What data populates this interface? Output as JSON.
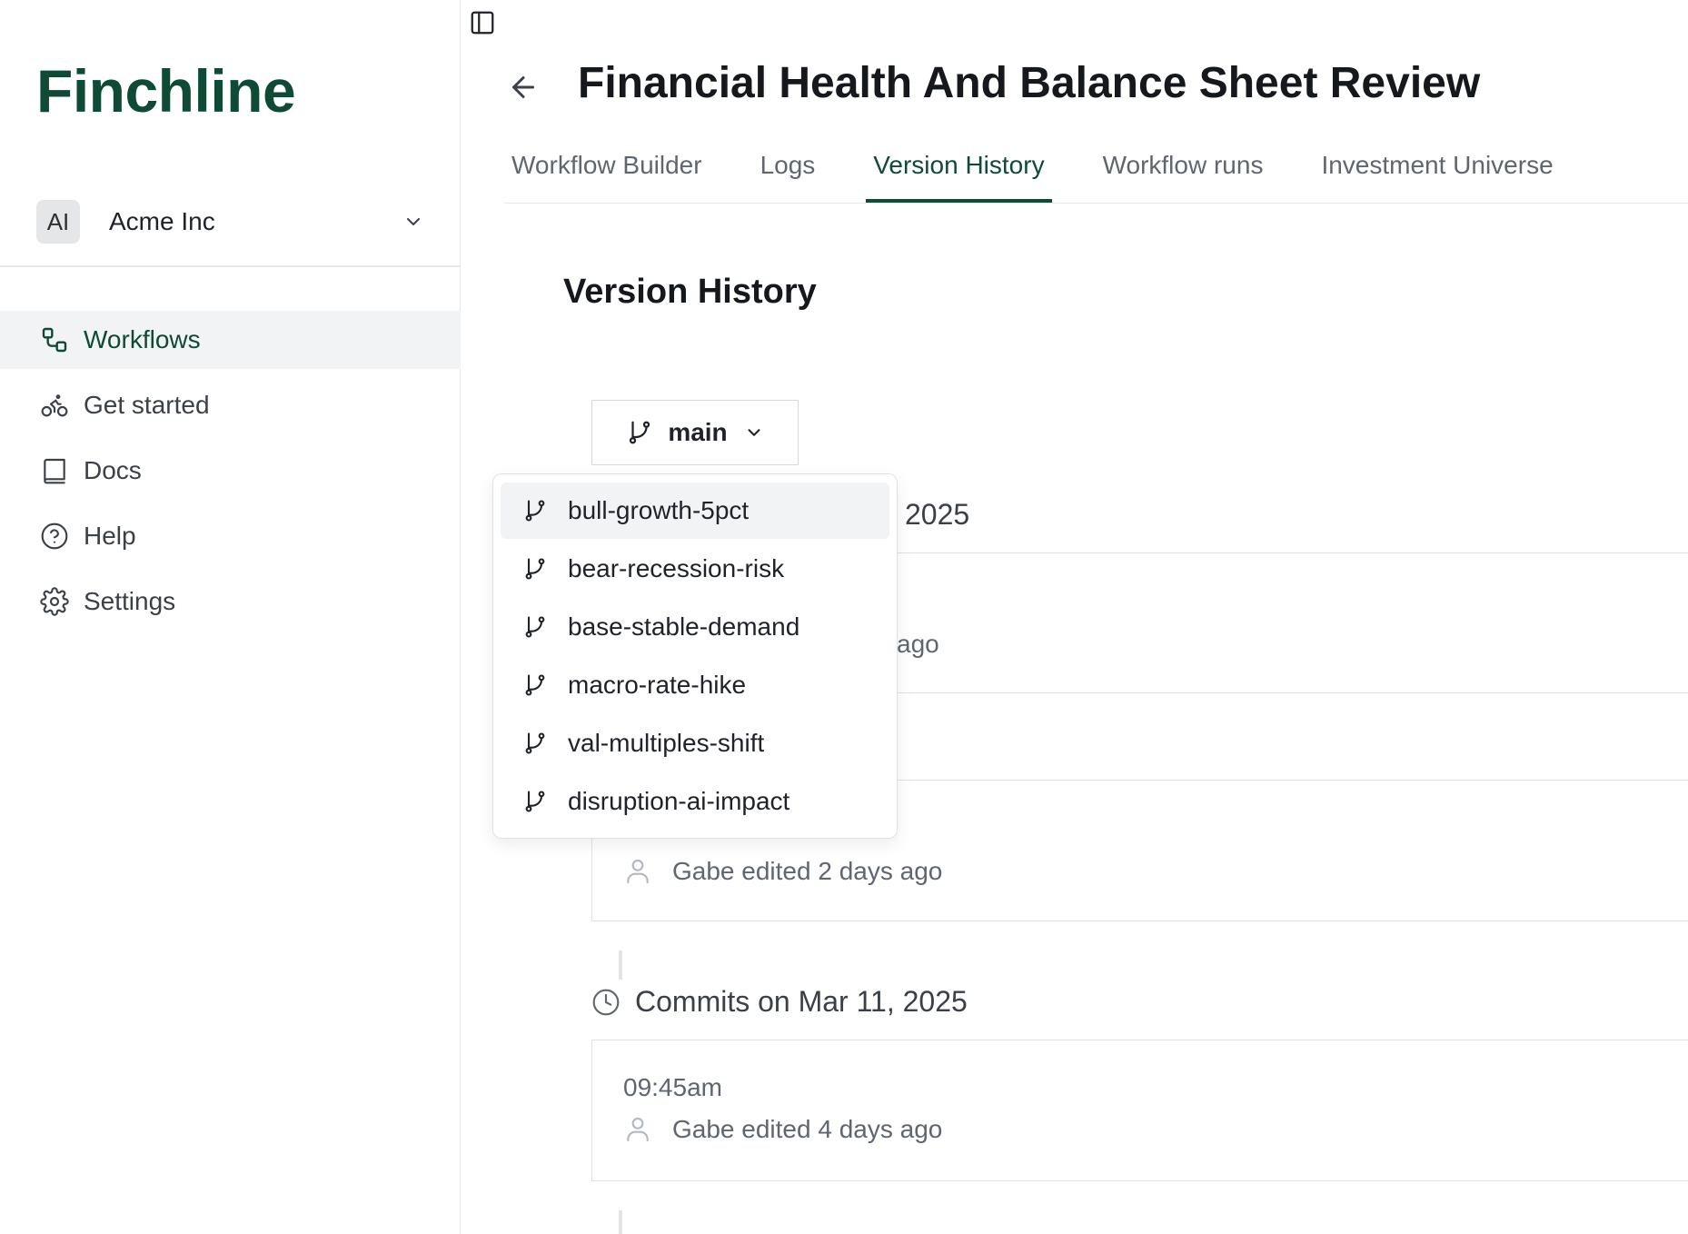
{
  "sidebar": {
    "brand": "Finchline",
    "org": {
      "initials": "AI",
      "name": "Acme Inc"
    },
    "items": [
      {
        "label": "Workflows",
        "icon": "workflow-icon",
        "active": true
      },
      {
        "label": "Get started",
        "icon": "bike-icon"
      },
      {
        "label": "Docs",
        "icon": "book-icon"
      },
      {
        "label": "Help",
        "icon": "help-circle-icon"
      },
      {
        "label": "Settings",
        "icon": "gear-icon"
      }
    ]
  },
  "header": {
    "title": "Financial Health And Balance Sheet Review",
    "tabs": [
      "Workflow Builder",
      "Logs",
      "Version History",
      "Workflow runs",
      "Investment Universe"
    ],
    "active_tab": "Version History"
  },
  "version_history": {
    "title": "Version History",
    "branch": "main",
    "groups": [
      {
        "heading_partial": "2025",
        "commits": [
          {
            "time": "",
            "meta_partial": "ago"
          },
          {
            "time": "",
            "meta_partial": ""
          },
          {
            "time": "",
            "meta": "Gabe edited 2 days ago"
          }
        ]
      },
      {
        "heading": "Commits on Mar 11, 2025",
        "commits": [
          {
            "time": "09:45am",
            "meta": "Gabe edited 4 days ago"
          }
        ]
      }
    ]
  },
  "branch_dropdown": {
    "options": [
      "bull-growth-5pct",
      "bear-recession-risk",
      "base-stable-demand",
      "macro-rate-hike",
      "val-multiples-shift",
      "disruption-ai-impact"
    ],
    "highlighted": "bull-growth-5pct"
  },
  "colors": {
    "brand": "#0f4a35",
    "text": "#1f2329",
    "muted": "#5f6670",
    "hover": "#f2f3f5"
  }
}
